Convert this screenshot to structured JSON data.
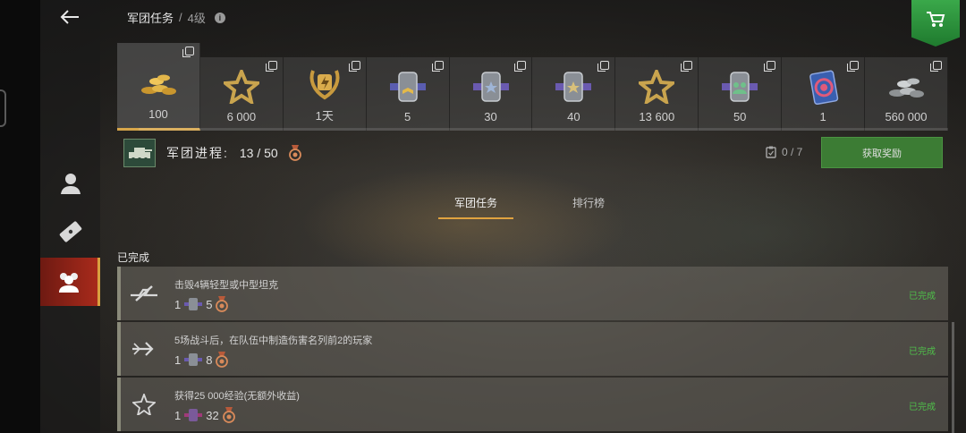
{
  "header": {
    "breadcrumb_main": "军团任务",
    "breadcrumb_sep": "/",
    "breadcrumb_level": "4级",
    "info_icon": "info-icon",
    "back_icon": "arrow-left-icon",
    "shop_icon": "cart-icon"
  },
  "sidebar": {
    "items": [
      {
        "icon": "person-icon"
      },
      {
        "icon": "ticket-icon"
      },
      {
        "icon": "clan-icon",
        "active": true
      }
    ]
  },
  "rewards": [
    {
      "value": "100",
      "icon": "gold-coins-icon"
    },
    {
      "value": "6 000",
      "icon": "star-icon"
    },
    {
      "value": "1天",
      "icon": "premium-wreath-icon"
    },
    {
      "value": "5",
      "icon": "commander-badge-icon"
    },
    {
      "value": "30",
      "icon": "badge-star-icon"
    },
    {
      "value": "40",
      "icon": "badge-star-icon"
    },
    {
      "value": "13 600",
      "icon": "star-icon"
    },
    {
      "value": "50",
      "icon": "badge-crew-icon"
    },
    {
      "value": "1",
      "icon": "card-icon"
    },
    {
      "value": "560 000",
      "icon": "silver-coins-icon"
    }
  ],
  "progress": {
    "label": "军团进程:",
    "count": "13 / 50",
    "fraction": 0.026
  },
  "claim": {
    "count": "0 / 7",
    "button_label": "获取奖励"
  },
  "tabs": [
    {
      "label": "军团任务",
      "active": true
    },
    {
      "label": "排行榜",
      "active": false
    }
  ],
  "section_title": "已完成",
  "tasks": [
    {
      "desc": "击毁4辆轻型或中型坦克",
      "reward_qty": "1",
      "medal_qty": "5",
      "status": "已完成",
      "icon": "destroy-tank-icon"
    },
    {
      "desc": "5场战斗后，在队伍中制造伤害名列前2的玩家",
      "reward_qty": "1",
      "medal_qty": "8",
      "status": "已完成",
      "icon": "damage-arrow-icon"
    },
    {
      "desc": "获得25 000经验(无额外收益)",
      "reward_qty": "1",
      "medal_qty": "32",
      "status": "已完成",
      "icon": "star-outline-icon"
    }
  ],
  "colors": {
    "accent_gold": "#d7a64a",
    "active_red": "#a82a1b",
    "claim_green": "#3c7c34",
    "status_green": "#4fbf4a"
  }
}
